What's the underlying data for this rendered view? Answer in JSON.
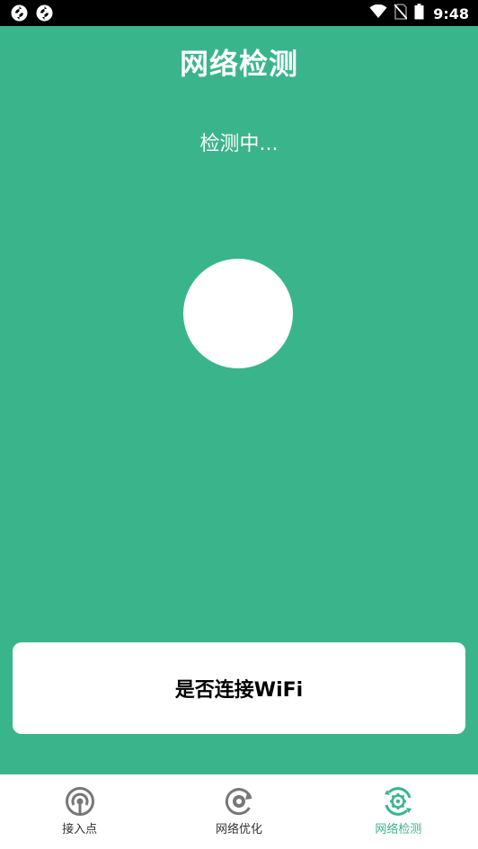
{
  "status_bar": {
    "time": "9:48",
    "left_icons": [
      "app-notification-icon",
      "app-notification-icon"
    ],
    "right_icons": [
      "wifi-signal-icon",
      "no-sim-icon",
      "battery-icon"
    ]
  },
  "header": {
    "title": "网络检测"
  },
  "main": {
    "status_text": "检测中..."
  },
  "card": {
    "label": "是否连接WiFi"
  },
  "bottom_nav": {
    "items": [
      {
        "label": "接入点",
        "icon": "access-point-icon",
        "active": false
      },
      {
        "label": "网络优化",
        "icon": "network-optimize-icon",
        "active": false
      },
      {
        "label": "网络检测",
        "icon": "network-detect-icon",
        "active": true
      }
    ]
  },
  "colors": {
    "background": "#3ab58b",
    "accent": "#3ab58b",
    "inactive_icon": "#777777",
    "status_bar": "#000000"
  }
}
